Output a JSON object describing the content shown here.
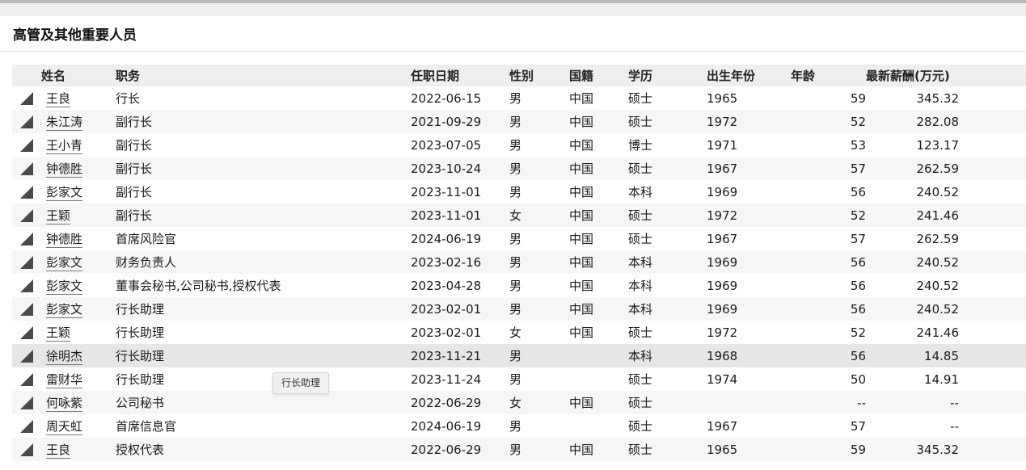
{
  "section": {
    "title": "高管及其他重要人员"
  },
  "table": {
    "headers": {
      "name": "姓名",
      "role": "职务",
      "date": "任职日期",
      "sex": "性别",
      "nationality": "国籍",
      "education": "学历",
      "birth_year": "出生年份",
      "age": "年龄",
      "salary": "最新薪酬(万元)"
    },
    "rows": [
      {
        "name": "王良",
        "role": "行长",
        "date": "2022-06-15",
        "sex": "男",
        "nationality": "中国",
        "education": "硕士",
        "birth_year": "1965",
        "age": "59",
        "salary": "345.32"
      },
      {
        "name": "朱江涛",
        "role": "副行长",
        "date": "2021-09-29",
        "sex": "男",
        "nationality": "中国",
        "education": "硕士",
        "birth_year": "1972",
        "age": "52",
        "salary": "282.08"
      },
      {
        "name": "王小青",
        "role": "副行长",
        "date": "2023-07-05",
        "sex": "男",
        "nationality": "中国",
        "education": "博士",
        "birth_year": "1971",
        "age": "53",
        "salary": "123.17"
      },
      {
        "name": "钟德胜",
        "role": "副行长",
        "date": "2023-10-24",
        "sex": "男",
        "nationality": "中国",
        "education": "硕士",
        "birth_year": "1967",
        "age": "57",
        "salary": "262.59"
      },
      {
        "name": "彭家文",
        "role": "副行长",
        "date": "2023-11-01",
        "sex": "男",
        "nationality": "中国",
        "education": "本科",
        "birth_year": "1969",
        "age": "56",
        "salary": "240.52"
      },
      {
        "name": "王颖",
        "role": "副行长",
        "date": "2023-11-01",
        "sex": "女",
        "nationality": "中国",
        "education": "硕士",
        "birth_year": "1972",
        "age": "52",
        "salary": "241.46"
      },
      {
        "name": "钟德胜",
        "role": "首席风险官",
        "date": "2024-06-19",
        "sex": "男",
        "nationality": "中国",
        "education": "硕士",
        "birth_year": "1967",
        "age": "57",
        "salary": "262.59"
      },
      {
        "name": "彭家文",
        "role": "财务负责人",
        "date": "2023-02-16",
        "sex": "男",
        "nationality": "中国",
        "education": "本科",
        "birth_year": "1969",
        "age": "56",
        "salary": "240.52"
      },
      {
        "name": "彭家文",
        "role": "董事会秘书,公司秘书,授权代表",
        "date": "2023-04-28",
        "sex": "男",
        "nationality": "中国",
        "education": "本科",
        "birth_year": "1969",
        "age": "56",
        "salary": "240.52"
      },
      {
        "name": "彭家文",
        "role": "行长助理",
        "date": "2023-02-01",
        "sex": "男",
        "nationality": "中国",
        "education": "本科",
        "birth_year": "1969",
        "age": "56",
        "salary": "240.52"
      },
      {
        "name": "王颖",
        "role": "行长助理",
        "date": "2023-02-01",
        "sex": "女",
        "nationality": "中国",
        "education": "硕士",
        "birth_year": "1972",
        "age": "52",
        "salary": "241.46"
      },
      {
        "name": "徐明杰",
        "role": "行长助理",
        "date": "2023-11-21",
        "sex": "男",
        "nationality": "",
        "education": "本科",
        "birth_year": "1968",
        "age": "56",
        "salary": "14.85"
      },
      {
        "name": "雷财华",
        "role": "行长助理",
        "date": "2023-11-24",
        "sex": "男",
        "nationality": "",
        "education": "硕士",
        "birth_year": "1974",
        "age": "50",
        "salary": "14.91"
      },
      {
        "name": "何咏紫",
        "role": "公司秘书",
        "date": "2022-06-29",
        "sex": "女",
        "nationality": "中国",
        "education": "硕士",
        "birth_year": "",
        "age": "--",
        "salary": "--"
      },
      {
        "name": "周天虹",
        "role": "首席信息官",
        "date": "2024-06-19",
        "sex": "男",
        "nationality": "",
        "education": "硕士",
        "birth_year": "1967",
        "age": "57",
        "salary": "--"
      },
      {
        "name": "王良",
        "role": "授权代表",
        "date": "2022-06-29",
        "sex": "男",
        "nationality": "中国",
        "education": "硕士",
        "birth_year": "1965",
        "age": "59",
        "salary": "345.32"
      }
    ]
  },
  "tooltip": {
    "text": "行长助理"
  }
}
